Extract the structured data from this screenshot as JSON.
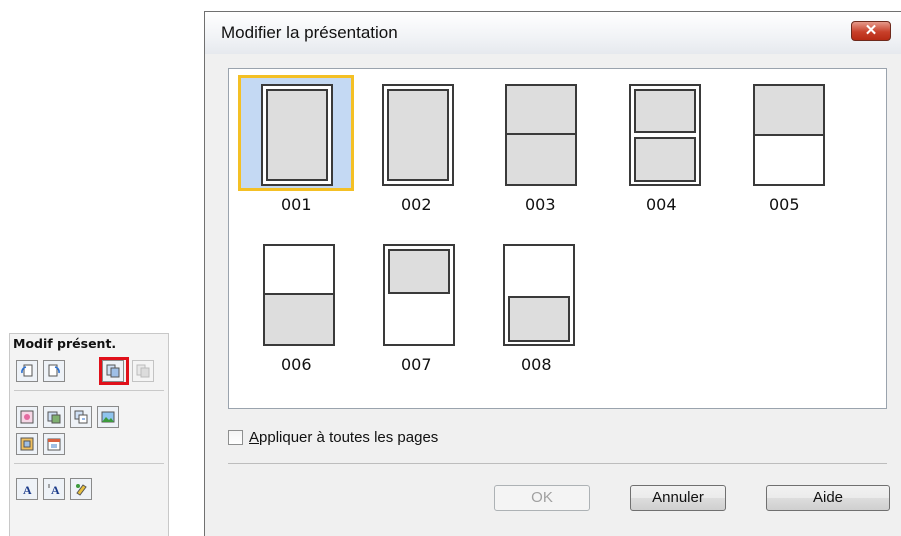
{
  "palette": {
    "title": "Modif présent."
  },
  "dialog": {
    "title": "Modifier la présentation",
    "close_label": "✕",
    "layouts": [
      {
        "label": "001",
        "selected": true
      },
      {
        "label": "002",
        "selected": false
      },
      {
        "label": "003",
        "selected": false
      },
      {
        "label": "004",
        "selected": false
      },
      {
        "label": "005",
        "selected": false
      },
      {
        "label": "006",
        "selected": false
      },
      {
        "label": "007",
        "selected": false
      },
      {
        "label": "008",
        "selected": false
      }
    ],
    "apply_all": {
      "label": "Appliquer à toutes les pages",
      "checked": false
    },
    "buttons": {
      "ok": "OK",
      "cancel": "Annuler",
      "help": "Aide"
    }
  },
  "colors": {
    "selection_fill": "#c4d9f3",
    "selection_border": "#f4c025",
    "highlight_red": "#e0101a",
    "close_button": "#c8402a"
  }
}
